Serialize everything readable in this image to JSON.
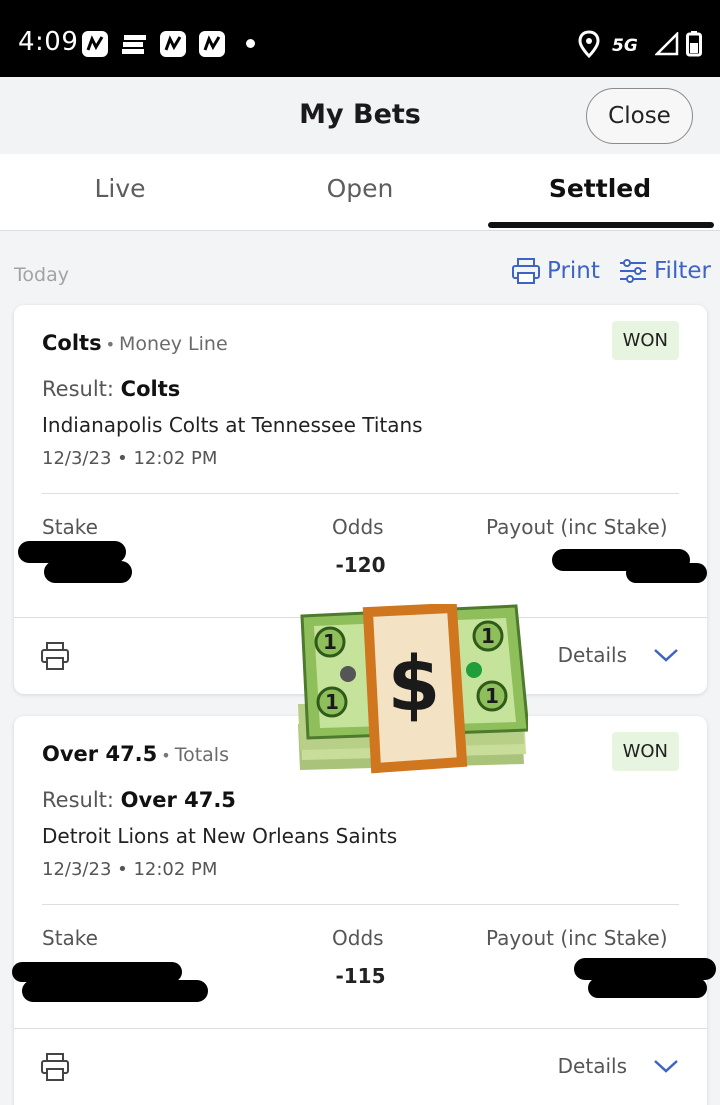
{
  "status_bar": {
    "time": "4:09",
    "network": "5G",
    "app_icons": [
      "app-icon",
      "espn-icon",
      "app-icon",
      "app-icon"
    ],
    "right_icons": [
      "location-icon",
      "signal-icon",
      "battery-icon"
    ]
  },
  "header": {
    "title": "My Bets",
    "close_label": "Close"
  },
  "tabs": [
    {
      "label": "Live",
      "active": false
    },
    {
      "label": "Open",
      "active": false
    },
    {
      "label": "Settled",
      "active": true
    }
  ],
  "toolbar": {
    "date_label": "Today",
    "print_label": "Print",
    "filter_label": "Filter"
  },
  "bets": [
    {
      "selection": "Colts",
      "market": "Money Line",
      "status": "WON",
      "result_label": "Result:",
      "result_value": "Colts",
      "event": "Indianapolis Colts at Tennessee Titans",
      "datetime": "12/3/23 • 12:02 PM",
      "stake_label": "Stake",
      "odds_label": "Odds",
      "odds_value": "-120",
      "payout_label": "Payout (inc Stake)",
      "details_label": "Details"
    },
    {
      "selection": "Over 47.5",
      "market": "Totals",
      "status": "WON",
      "result_label": "Result:",
      "result_value": "Over 47.5",
      "event": "Detroit Lions at New Orleans Saints",
      "datetime": "12/3/23 • 12:02 PM",
      "stake_label": "Stake",
      "odds_label": "Odds",
      "odds_value": "-115",
      "payout_label": "Payout (inc Stake)",
      "details_label": "Details"
    }
  ],
  "colors": {
    "accent": "#3d64c4",
    "won_badge_bg": "#e6f4e0",
    "money_green": "#4caf50"
  }
}
